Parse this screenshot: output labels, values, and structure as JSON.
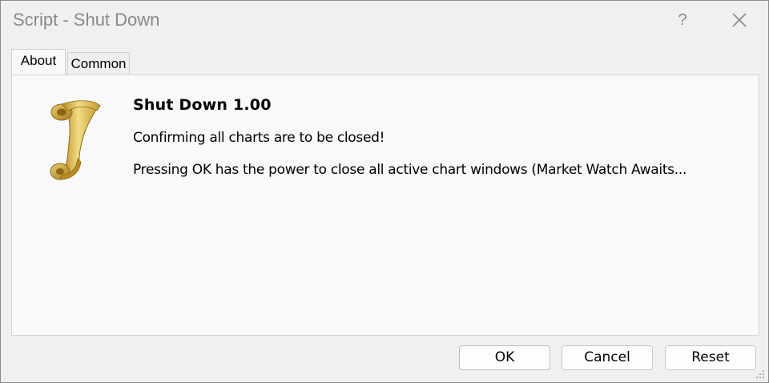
{
  "window": {
    "title": "Script - Shut Down",
    "help_label": "?",
    "close_label": "✕"
  },
  "tabs": [
    {
      "label": "About",
      "active": true
    },
    {
      "label": "Common",
      "active": false
    }
  ],
  "about": {
    "icon": "scroll-icon",
    "heading": "Shut Down 1.00",
    "line1": "Confirming all charts are to be closed!",
    "line2": "Pressing OK has the power to close all active chart windows (Market Watch Awaits..."
  },
  "buttons": {
    "ok": "OK",
    "cancel": "Cancel",
    "reset": "Reset"
  },
  "colors": {
    "scroll_gold": "#d9b74a",
    "scroll_shadow": "#a07a1c",
    "title_text": "#8a8a8a"
  }
}
